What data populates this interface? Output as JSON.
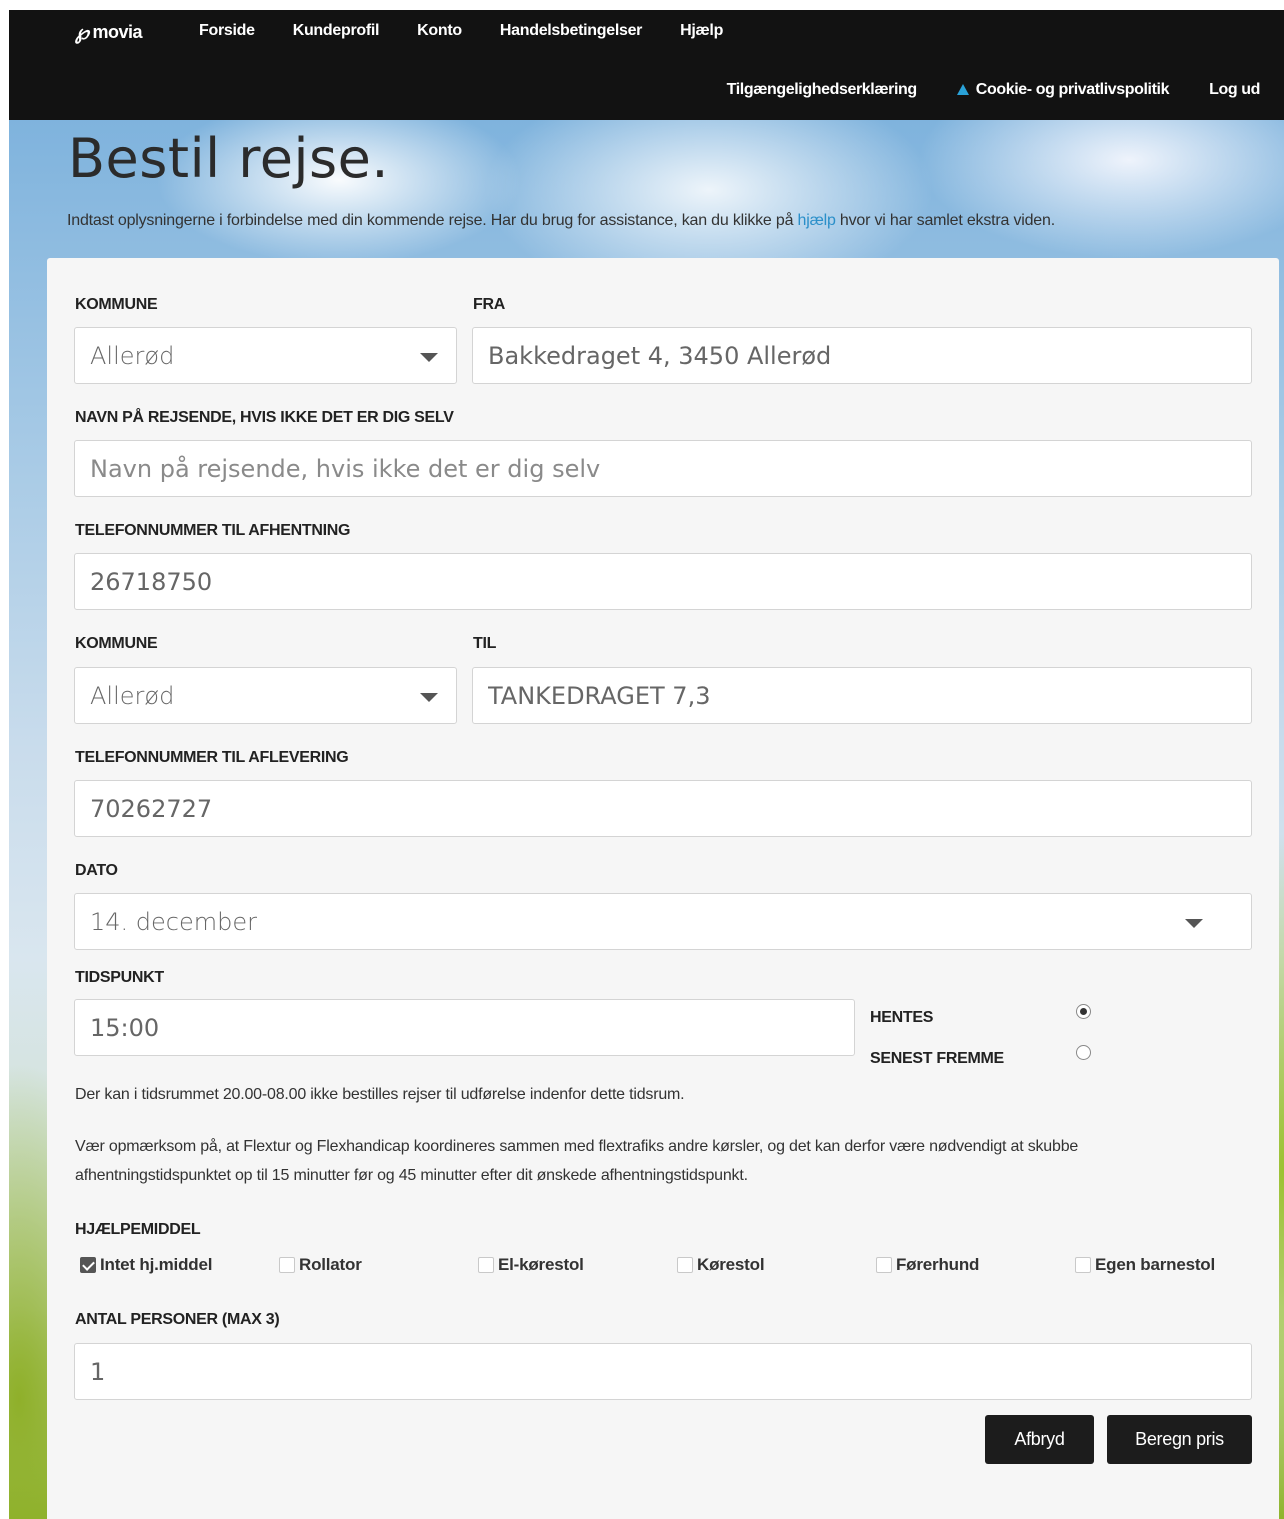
{
  "nav": {
    "logo": "movia",
    "main_links": [
      "Forside",
      "Kundeprofil",
      "Konto",
      "Handelsbetingelser",
      "Hjælp"
    ],
    "accessibility": "Tilgængelighedserklæring",
    "cookie": "Cookie- og privatlivspolitik",
    "logout": "Log ud"
  },
  "page": {
    "title": "Bestil rejse.",
    "intro_before": "Indtast oplysningerne i forbindelse med din kommende rejse. Har du brug for assistance, kan du klikke på ",
    "intro_link": "hjælp",
    "intro_after": " hvor vi har samlet ekstra viden."
  },
  "form": {
    "kommune_from_label": "KOMMUNE",
    "kommune_from_value": "Allerød",
    "fra_label": "FRA",
    "fra_value": "Bakkedraget 4, 3450 Allerød",
    "navn_label": "NAVN PÅ REJSENDE, HVIS IKKE DET ER DIG SELV",
    "navn_placeholder": "Navn på rejsende, hvis ikke det er dig selv",
    "tlf_afhent_label": "TELEFONNUMMER TIL AFHENTNING",
    "tlf_afhent_value": "26718750",
    "kommune_to_label": "KOMMUNE",
    "kommune_to_value": "Allerød",
    "til_label": "TIL",
    "til_value": "TANKEDRAGET 7,3",
    "tlf_aflever_label": "TELEFONNUMMER TIL AFLEVERING",
    "tlf_aflever_value": "70262727",
    "dato_label": "DATO",
    "dato_value": "14. december",
    "tid_label": "TIDSPUNKT",
    "tid_value": "15:00",
    "hentes_label": "HENTES",
    "senest_label": "SENEST FREMME",
    "time_mode_selected": "HENTES",
    "note1": "Der kan i tidsrummet 20.00-08.00 ikke bestilles rejser til udførelse indenfor dette tidsrum.",
    "note2_line1": "Vær opmærksom på, at Flextur og Flexhandicap koordineres sammen med flextrafiks andre kørsler, og det kan derfor være nødvendigt at skubbe",
    "note2_line2": "afhentningstidspunktet op til 15 minutter før og 45 minutter efter dit ønskede afhentningstidspunkt.",
    "hjaelp_label": "HJÆLPEMIDDEL",
    "aids": [
      {
        "label": "Intet hj.middel",
        "checked": true
      },
      {
        "label": "Rollator",
        "checked": false
      },
      {
        "label": "El-kørestol",
        "checked": false
      },
      {
        "label": "Kørestol",
        "checked": false
      },
      {
        "label": "Førerhund",
        "checked": false
      },
      {
        "label": "Egen barnestol",
        "checked": false
      }
    ],
    "antal_label": "ANTAL PERSONER (MAX 3)",
    "antal_value": "1",
    "cancel_label": "Afbryd",
    "submit_label": "Beregn pris"
  }
}
